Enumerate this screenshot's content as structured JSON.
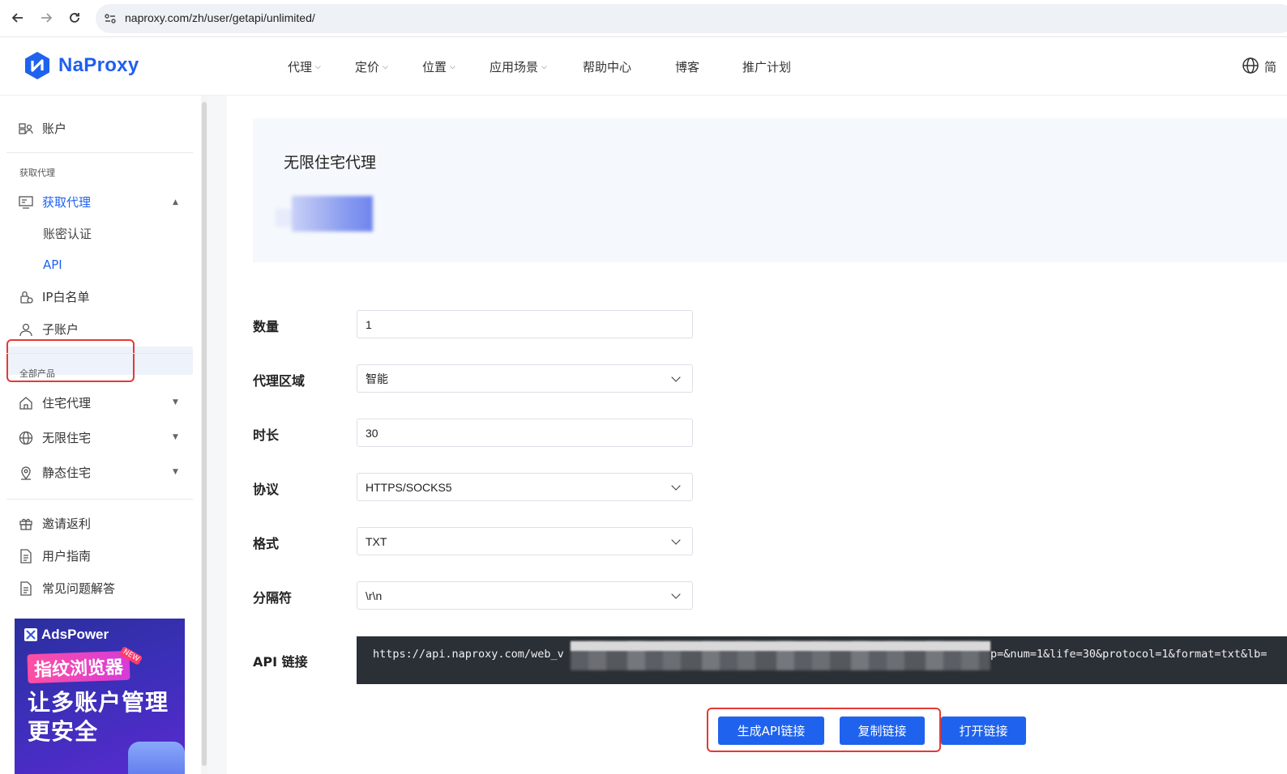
{
  "browser": {
    "url": "naproxy.com/zh/user/getapi/unlimited/"
  },
  "header": {
    "brand": "NaProxy",
    "nav": [
      {
        "label": "代理",
        "has_dropdown": true
      },
      {
        "label": "定价",
        "has_dropdown": true
      },
      {
        "label": "位置",
        "has_dropdown": true
      },
      {
        "label": "应用场景",
        "has_dropdown": true
      },
      {
        "label": "帮助中心",
        "has_dropdown": false
      },
      {
        "label": "博客",
        "has_dropdown": false
      },
      {
        "label": "推广计划",
        "has_dropdown": false
      }
    ],
    "lang_partial": "简"
  },
  "sidebar": {
    "account": "账户",
    "section_get_proxy": "获取代理",
    "get_proxy": "获取代理",
    "sub_auth": "账密认证",
    "sub_api": "API",
    "ip_whitelist": "IP白名单",
    "sub_account": "子账户",
    "section_all_products": "全部产品",
    "residential": "住宅代理",
    "unlimited_residential": "无限住宅",
    "static_residential": "静态住宅",
    "invite": "邀请返利",
    "user_guide": "用户指南",
    "faq": "常见问题解答"
  },
  "ad": {
    "brand": "AdsPower",
    "tag": "指纹浏览器",
    "badge": "NEW",
    "line1": "让多账户管理",
    "line2": "更安全"
  },
  "card": {
    "title": "无限住宅代理"
  },
  "form": {
    "quantity_label": "数量",
    "quantity_value": "1",
    "region_label": "代理区域",
    "region_value": "智能",
    "duration_label": "时长",
    "duration_value": "30",
    "protocol_label": "协议",
    "protocol_value": "HTTPS/SOCKS5",
    "format_label": "格式",
    "format_value": "TXT",
    "separator_label": "分隔符",
    "separator_value": "\\r\\n",
    "api_link_label": "API 链接",
    "api_link_prefix": "https://api.naproxy.com/web_v",
    "api_link_suffix": "p=&num=1&life=30&protocol=1&format=txt&lb="
  },
  "buttons": {
    "generate": "生成API链接",
    "copy": "复制链接",
    "open": "打开链接"
  },
  "colors": {
    "brand_blue": "#1f62ee",
    "highlight_red": "#e53935",
    "code_bg": "#2b2f36"
  }
}
